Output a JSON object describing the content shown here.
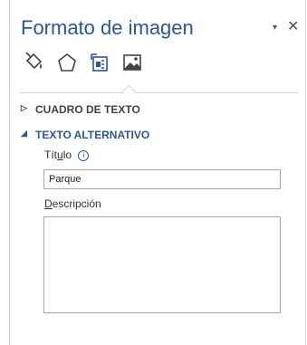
{
  "pane": {
    "title": "Formato de imagen",
    "menu_icon": "▾",
    "close_icon": "✕"
  },
  "tabs": [
    {
      "name": "fill-line-icon",
      "selected": false
    },
    {
      "name": "effects-icon",
      "selected": false
    },
    {
      "name": "layout-properties-icon",
      "selected": true
    },
    {
      "name": "picture-icon",
      "selected": false
    }
  ],
  "sections": {
    "cuadro": {
      "label": "CUADRO DE TEXTO",
      "arrow": "▷"
    },
    "alt": {
      "label": "TEXTO ALTERNATIVO",
      "arrow": "◢"
    }
  },
  "alt_text": {
    "title_label_pre": "Tít",
    "title_label_u": "u",
    "title_label_post": "lo",
    "title_value": "Parque",
    "description_label_u": "D",
    "description_label_rest": "escripción",
    "description_value": ""
  },
  "colors": {
    "accent": "#2b579a",
    "border": "#a8a8a8"
  }
}
